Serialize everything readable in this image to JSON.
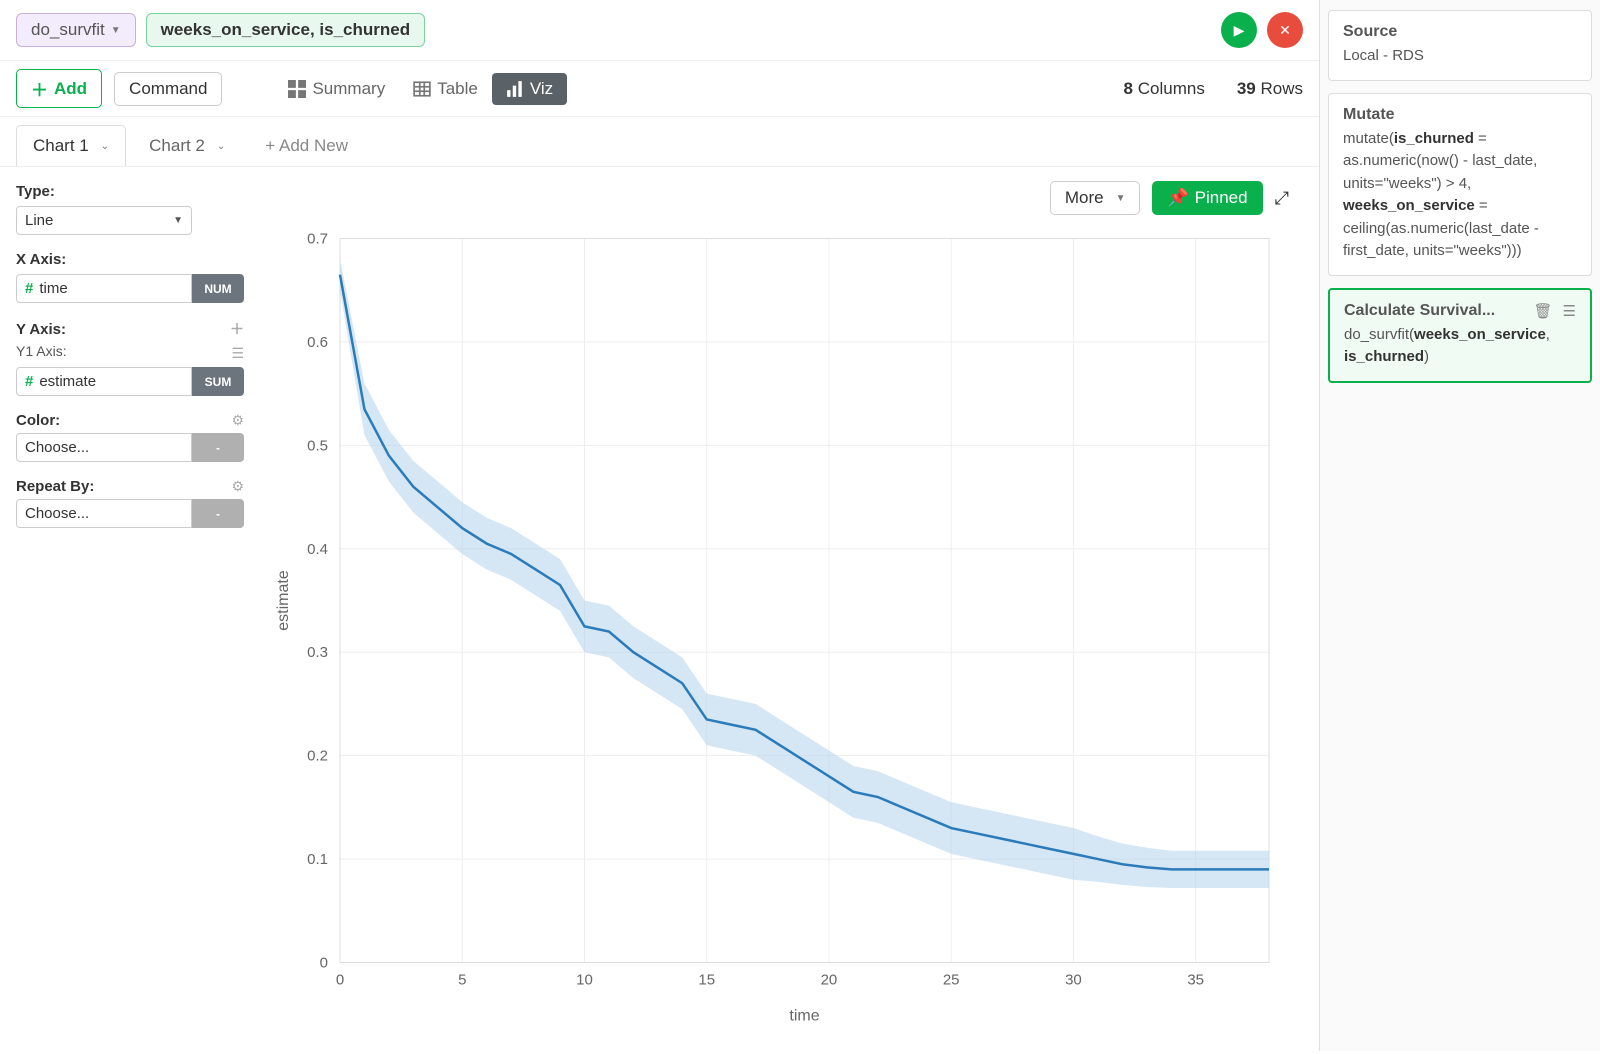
{
  "header": {
    "function_pill": "do_survfit",
    "args_pill_parts": [
      "weeks_on_service",
      ", ",
      "is_churned"
    ]
  },
  "toolbar": {
    "add_label": "Add",
    "command_label": "Command",
    "views": {
      "summary": "Summary",
      "table": "Table",
      "viz": "Viz"
    },
    "columns_count": "8",
    "columns_label": "Columns",
    "rows_count": "39",
    "rows_label": "Rows"
  },
  "chart_tabs": {
    "tab1": "Chart 1",
    "tab2": "Chart 2",
    "add_new": "+ Add New"
  },
  "chart_controls": {
    "more_label": "More",
    "pinned_label": "Pinned"
  },
  "config": {
    "type_label": "Type:",
    "type_value": "Line",
    "xaxis_label": "X Axis:",
    "xaxis_value": "time",
    "xaxis_badge": "NUM",
    "yaxis_label": "Y Axis:",
    "y1_label": "Y1 Axis:",
    "yaxis_value": "estimate",
    "yaxis_badge": "SUM",
    "color_label": "Color:",
    "color_value": "Choose...",
    "color_badge": "-",
    "repeat_label": "Repeat By:",
    "repeat_value": "Choose...",
    "repeat_badge": "-"
  },
  "sidebar": {
    "source_title": "Source",
    "source_body": "Local - RDS",
    "mutate_title": "Mutate",
    "mutate_prefix": "mutate(",
    "mutate_b1": "is_churned",
    "mutate_mid1": " = as.numeric(now() - last_date, units=\"weeks\") > 4, ",
    "mutate_b2": "weeks_on_service",
    "mutate_mid2": " = ceiling(as.numeric(last_date - first_date, units=\"weeks\")))",
    "surv_title": "Calculate Survival...",
    "surv_prefix": "do_survfit(",
    "surv_b1": "weeks_on_service",
    "surv_mid": ", ",
    "surv_b2": "is_churned",
    "surv_suffix": ")"
  },
  "chart_data": {
    "type": "line",
    "xlabel": "time",
    "ylabel": "estimate",
    "xlim": [
      0,
      38
    ],
    "ylim": [
      0,
      0.7
    ],
    "x_ticks": [
      0,
      5,
      10,
      15,
      20,
      25,
      30,
      35
    ],
    "y_ticks": [
      0,
      0.1,
      0.2,
      0.3,
      0.4,
      0.5,
      0.6,
      0.7
    ],
    "series": [
      {
        "name": "estimate",
        "x": [
          0,
          1,
          2,
          3,
          4,
          5,
          6,
          7,
          8,
          9,
          10,
          11,
          12,
          13,
          14,
          15,
          16,
          17,
          18,
          19,
          20,
          21,
          22,
          23,
          24,
          25,
          26,
          27,
          28,
          29,
          30,
          31,
          32,
          33,
          34,
          35,
          36,
          37,
          38
        ],
        "y": [
          0.665,
          0.535,
          0.49,
          0.46,
          0.44,
          0.42,
          0.405,
          0.395,
          0.38,
          0.365,
          0.325,
          0.32,
          0.3,
          0.285,
          0.27,
          0.235,
          0.23,
          0.225,
          0.21,
          0.195,
          0.18,
          0.165,
          0.16,
          0.15,
          0.14,
          0.13,
          0.125,
          0.12,
          0.115,
          0.11,
          0.105,
          0.1,
          0.095,
          0.092,
          0.09,
          0.09,
          0.09,
          0.09,
          0.09
        ],
        "ci_low": [
          0.65,
          0.51,
          0.465,
          0.435,
          0.415,
          0.395,
          0.38,
          0.37,
          0.355,
          0.34,
          0.3,
          0.295,
          0.275,
          0.26,
          0.245,
          0.21,
          0.205,
          0.2,
          0.185,
          0.17,
          0.155,
          0.14,
          0.135,
          0.125,
          0.115,
          0.105,
          0.1,
          0.095,
          0.09,
          0.085,
          0.08,
          0.078,
          0.075,
          0.073,
          0.072,
          0.072,
          0.072,
          0.072,
          0.072
        ],
        "ci_high": [
          0.68,
          0.56,
          0.515,
          0.485,
          0.465,
          0.445,
          0.43,
          0.42,
          0.405,
          0.39,
          0.35,
          0.345,
          0.325,
          0.31,
          0.295,
          0.26,
          0.255,
          0.25,
          0.235,
          0.22,
          0.205,
          0.19,
          0.185,
          0.175,
          0.165,
          0.155,
          0.15,
          0.145,
          0.14,
          0.135,
          0.13,
          0.122,
          0.115,
          0.111,
          0.108,
          0.108,
          0.108,
          0.108,
          0.108
        ]
      }
    ]
  }
}
